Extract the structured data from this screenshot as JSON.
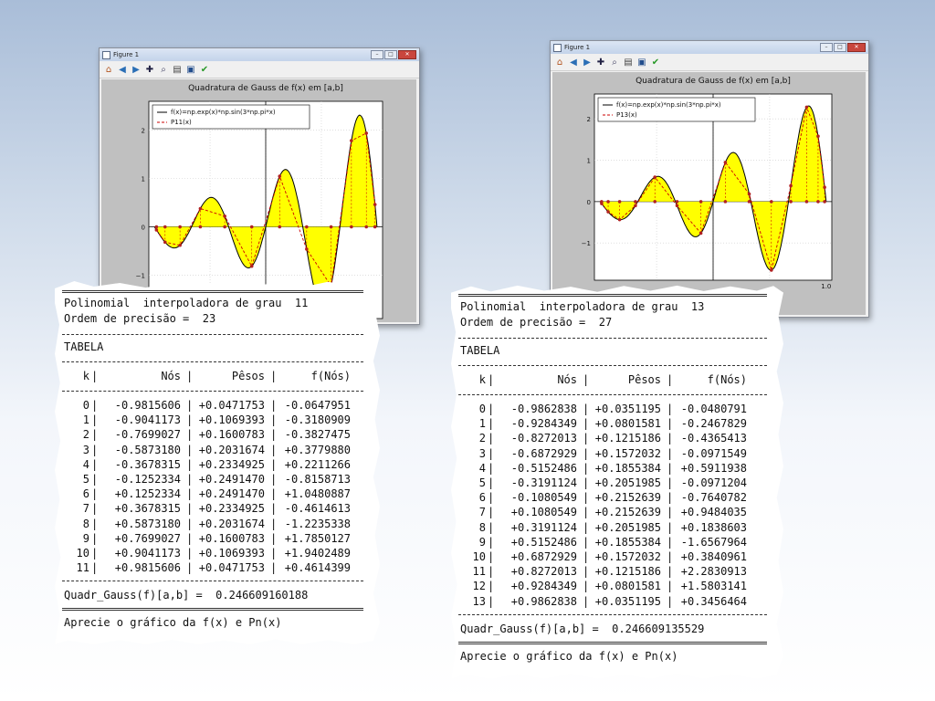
{
  "windows": [
    {
      "title": "Figure 1",
      "plot_title": "Quadratura de Gauss de f(x) em [a,b]",
      "legend": [
        "f(x)=np.exp(x)*np.sin(3*np.pi*x)",
        "P11(x)"
      ],
      "y_ticks": [
        "2",
        "1",
        "0",
        "−1"
      ],
      "x_ticks": []
    },
    {
      "title": "Figure 1",
      "plot_title": "Quadratura de Gauss de f(x) em [a,b]",
      "legend": [
        "f(x)=np.exp(x)*np.sin(3*np.pi*x)",
        "P13(x)"
      ],
      "y_ticks": [
        "2",
        "1",
        "0",
        "−1"
      ],
      "x_ticks": [
        "1.0"
      ]
    }
  ],
  "toolbar_icons": [
    "home-icon",
    "back-icon",
    "forward-icon",
    "pan-icon",
    "zoom-icon",
    "subplots-icon",
    "save-icon",
    "check-icon"
  ],
  "outputs": [
    {
      "line1": "Polinomial  interpoladora de grau  11",
      "line2": "Ordem de precisão =  23",
      "tabela": "TABELA",
      "headers": [
        "k",
        "Nós",
        "Pêsos",
        "f(Nós)"
      ],
      "rows": [
        [
          "0",
          "-0.9815606",
          "+0.0471753",
          "-0.0647951"
        ],
        [
          "1",
          "-0.9041173",
          "+0.1069393",
          "-0.3180909"
        ],
        [
          "2",
          "-0.7699027",
          "+0.1600783",
          "-0.3827475"
        ],
        [
          "3",
          "-0.5873180",
          "+0.2031674",
          "+0.3779880"
        ],
        [
          "4",
          "-0.3678315",
          "+0.2334925",
          "+0.2211266"
        ],
        [
          "5",
          "-0.1252334",
          "+0.2491470",
          "-0.8158713"
        ],
        [
          "6",
          "+0.1252334",
          "+0.2491470",
          "+1.0480887"
        ],
        [
          "7",
          "+0.3678315",
          "+0.2334925",
          "-0.4614613"
        ],
        [
          "8",
          "+0.5873180",
          "+0.2031674",
          "-1.2235338"
        ],
        [
          "9",
          "+0.7699027",
          "+0.1600783",
          "+1.7850127"
        ],
        [
          "10",
          "+0.9041173",
          "+0.1069393",
          "+1.9402489"
        ],
        [
          "11",
          "+0.9815606",
          "+0.0471753",
          "+0.4614399"
        ]
      ],
      "quadr": "Quadr_Gauss(f)[a,b] =  0.246609160188",
      "aprecie": "Aprecie o gráfico da f(x) e Pn(x)"
    },
    {
      "line1": "Polinomial  interpoladora de grau  13",
      "line2": "Ordem de precisão =  27",
      "tabela": "TABELA",
      "headers": [
        "k",
        "Nós",
        "Pêsos",
        "f(Nós)"
      ],
      "rows": [
        [
          "0",
          "-0.9862838",
          "+0.0351195",
          "-0.0480791"
        ],
        [
          "1",
          "-0.9284349",
          "+0.0801581",
          "-0.2467829"
        ],
        [
          "2",
          "-0.8272013",
          "+0.1215186",
          "-0.4365413"
        ],
        [
          "3",
          "-0.6872929",
          "+0.1572032",
          "-0.0971549"
        ],
        [
          "4",
          "-0.5152486",
          "+0.1855384",
          "+0.5911938"
        ],
        [
          "5",
          "-0.3191124",
          "+0.2051985",
          "-0.0971204"
        ],
        [
          "6",
          "-0.1080549",
          "+0.2152639",
          "-0.7640782"
        ],
        [
          "7",
          "+0.1080549",
          "+0.2152639",
          "+0.9484035"
        ],
        [
          "8",
          "+0.3191124",
          "+0.2051985",
          "+0.1838603"
        ],
        [
          "9",
          "+0.5152486",
          "+0.1855384",
          "-1.6567964"
        ],
        [
          "10",
          "+0.6872929",
          "+0.1572032",
          "+0.3840961"
        ],
        [
          "11",
          "+0.8272013",
          "+0.1215186",
          "+2.2830913"
        ],
        [
          "12",
          "+0.9284349",
          "+0.0801581",
          "+1.5803141"
        ],
        [
          "13",
          "+0.9862838",
          "+0.0351195",
          "+0.3456464"
        ]
      ],
      "quadr": "Quadr_Gauss(f)[a,b] =  0.246609135529",
      "aprecie": "Aprecie o gráfico da f(x) e Pn(x)"
    }
  ],
  "colors": {
    "fill": "#ffff00",
    "curve": "#000000",
    "poly": "#cc0000",
    "nodes": "#b22222"
  }
}
